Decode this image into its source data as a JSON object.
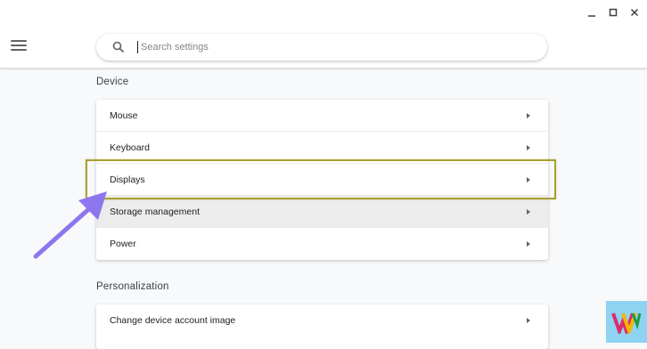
{
  "search": {
    "placeholder": "Search settings"
  },
  "device": {
    "title": "Device",
    "items": [
      {
        "label": "Mouse"
      },
      {
        "label": "Keyboard"
      },
      {
        "label": "Displays"
      },
      {
        "label": "Storage management"
      },
      {
        "label": "Power"
      }
    ]
  },
  "personalization": {
    "title": "Personalization",
    "items": [
      {
        "label": "Change device account image"
      }
    ]
  },
  "colors": {
    "highlight": "#a8a132",
    "pointer_arrow": "#8d76ee",
    "hover_row": "#ececec"
  },
  "icons": [
    "minimize-icon",
    "maximize-icon",
    "close-icon",
    "menu-icon",
    "search-icon",
    "chevron-right-icon",
    "watermark-logo"
  ]
}
